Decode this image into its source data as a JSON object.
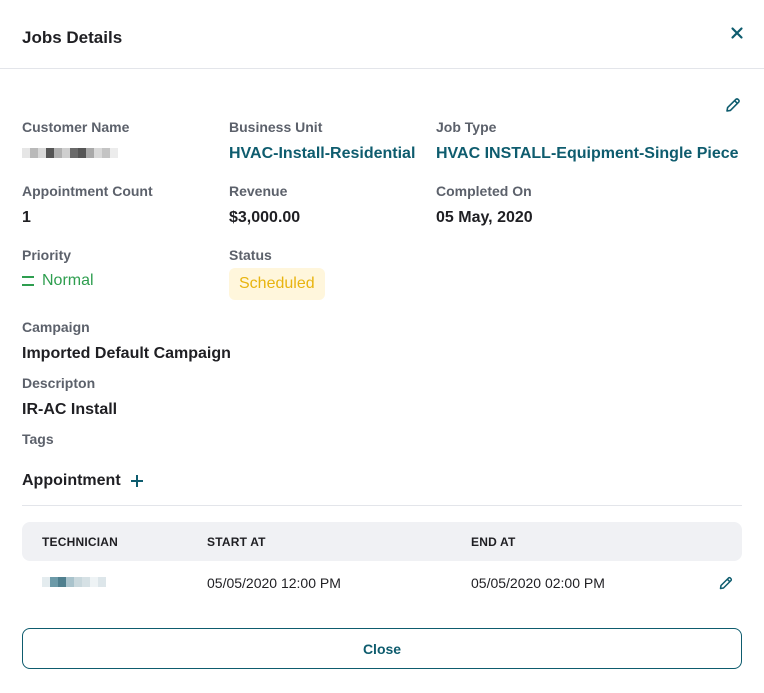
{
  "dialog": {
    "title": "Jobs Details",
    "close_button_label": "Close"
  },
  "fields": {
    "customer_name": {
      "label": "Customer Name"
    },
    "business_unit": {
      "label": "Business Unit",
      "value": "HVAC-Install-Residential"
    },
    "job_type": {
      "label": "Job Type",
      "value": "HVAC INSTALL-Equipment-Single Piece"
    },
    "appointment_count": {
      "label": "Appointment Count",
      "value": "1"
    },
    "revenue": {
      "label": "Revenue",
      "value": "$3,000.00"
    },
    "completed_on": {
      "label": "Completed On",
      "value": "05 May, 2020"
    },
    "priority": {
      "label": "Priority",
      "value": "Normal"
    },
    "status": {
      "label": "Status",
      "value": "Scheduled"
    },
    "campaign": {
      "label": "Campaign",
      "value": "Imported Default Campaign"
    },
    "description": {
      "label": "Descripton",
      "value": "IR-AC Install"
    },
    "tags": {
      "label": "Tags"
    }
  },
  "appointments": {
    "title": "Appointment",
    "columns": [
      "TECHNICIAN",
      "START AT",
      "END AT"
    ],
    "rows": [
      {
        "start_at": "05/05/2020 12:00 PM",
        "end_at": "05/05/2020 02:00 PM"
      }
    ]
  },
  "colors": {
    "accent": "#0e5c6e",
    "priority_green": "#2e9e4f",
    "status_text": "#e8b40f",
    "status_bg": "#fff6dc"
  },
  "icons": [
    "close-icon",
    "pencil-icon",
    "plus-icon",
    "equals-icon"
  ]
}
